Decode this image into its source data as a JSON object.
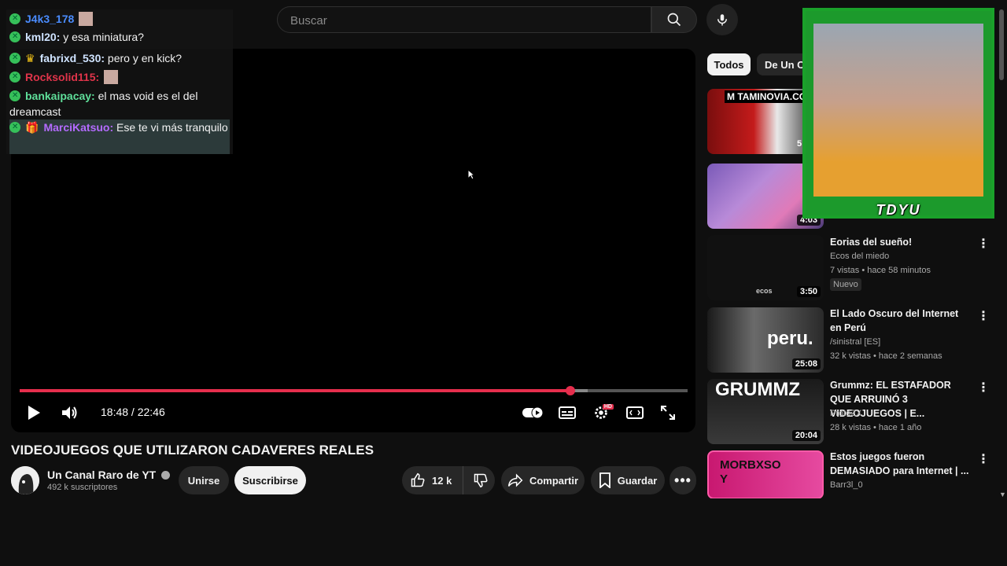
{
  "header": {
    "search_placeholder": "Buscar"
  },
  "chat": [
    {
      "user": "J4k3_178",
      "msg": "",
      "color": "#4a8cff"
    },
    {
      "user": "kml20:",
      "msg": " y esa miniatura?",
      "color": "#cfe3ff"
    },
    {
      "user": "fabrixd_530:",
      "msg": " pero y en kick?",
      "color": "#cfe3ff"
    },
    {
      "user": "Rocksolid115:",
      "msg": "",
      "color": "#e0344a"
    },
    {
      "user": "bankaipacay:",
      "msg": " el mas void es el del dreamcast",
      "color": "#5fdf9a"
    },
    {
      "user": "MarciKatsuo:",
      "msg": " Ese te vi más tranquilo",
      "color": "#b46bff"
    }
  ],
  "player": {
    "time": "18:48 / 22:46",
    "progress_fraction": 0.825,
    "hd_badge": "HD"
  },
  "video": {
    "title": "VIDEOJUEGOS QUE UTILIZARON CADAVERES REALES",
    "channel": "Un Canal Raro de YT",
    "subscribers": "492 k suscriptores",
    "join_label": "Unirse",
    "subscribe_label": "Suscribirse",
    "likes": "12 k",
    "share_label": "Compartir",
    "save_label": "Guardar"
  },
  "sidebar": {
    "chips": [
      "Todos",
      "De Un Ca"
    ],
    "webcam_label": "TDYU",
    "items": [
      {
        "title": "",
        "channel": "",
        "meta": "",
        "duration": "5",
        "thumb_text": "M TAMINOVIA.COM"
      },
      {
        "title": "",
        "channel": "",
        "meta": "",
        "duration": "4:03",
        "thumb_text": ""
      },
      {
        "title": "Eorias del sueño!",
        "channel": "Ecos del miedo",
        "meta": "7 vistas • hace 58 minutos",
        "badge": "Nuevo",
        "duration": "3:50",
        "thumb_text": "ecos"
      },
      {
        "title": "El Lado Oscuro del Internet en Perú",
        "channel": "/sinistral [ES]",
        "meta": "32 k vistas • hace 2 semanas",
        "duration": "25:08",
        "thumb_text": "peru."
      },
      {
        "title": "Grummz: EL ESTAFADOR QUE ARRUINÓ 3 VIDEOJUEGOS | E...",
        "channel": "ProtoZX",
        "meta": "28 k vistas • hace 1 año",
        "duration": "20:04",
        "thumb_text": "GRUMMZ"
      },
      {
        "title": "Estos juegos fueron DEMASIADO para Internet | ...",
        "channel": "Barr3l_0",
        "meta": "",
        "duration": "",
        "thumb_text": "MORBXSO Y"
      }
    ]
  }
}
